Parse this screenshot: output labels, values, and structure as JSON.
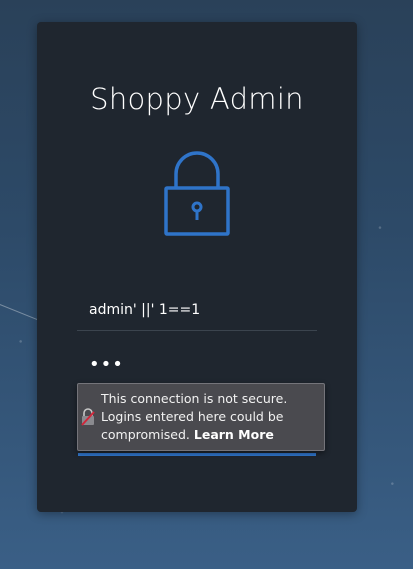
{
  "app": {
    "title": "Shoppy Admin"
  },
  "login": {
    "username_value": "admin' ||' 1==1",
    "password_masked": "•••"
  },
  "insecure_tooltip": {
    "line1": "This connection is not secure.",
    "line2": "Logins entered here could be",
    "line3_prefix": "compromised.",
    "learn_more_label": "Learn More"
  },
  "icons": {
    "main": "lock-icon",
    "tooltip": "insecure-lock-icon"
  },
  "colors": {
    "accent": "#2f74c9",
    "card_background": "#1f262f",
    "tooltip_background": "#4a4a4f",
    "insecure_red": "#d0263a"
  }
}
